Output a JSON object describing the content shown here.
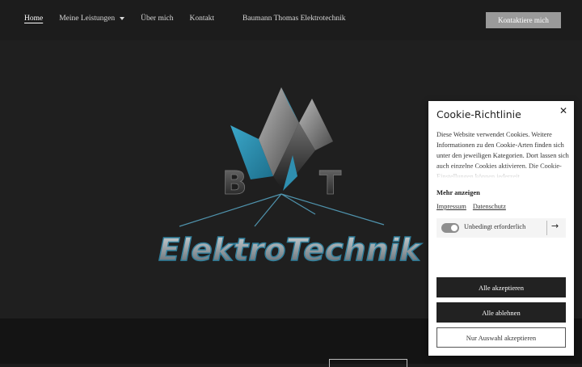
{
  "nav": {
    "items": [
      "Home",
      "Meine Leistungen",
      "Über mich",
      "Kontakt"
    ],
    "brand": "Baumann Thomas Elektrotechnik",
    "contact_button": "Kontaktiere mich"
  },
  "logo": {
    "letter_left": "B",
    "letter_right": "T",
    "wordmark": "ElektroTechnik"
  },
  "cookie": {
    "title": "Cookie-Richtlinie",
    "text": "Diese Website verwendet Cookies. Weitere Informationen zu den Cookie-Arten finden sich unter den jeweiligen Kategorien. Dort lassen sich auch einzelne Cookies aktivieren. Die Cookie-Einstellungen können jederzeit",
    "more": "Mehr anzeigen",
    "link_impressum": "Impressum",
    "link_datenschutz": "Datenschutz",
    "toggle_label": "Unbedingt erforderlich",
    "accept_all": "Alle akzeptieren",
    "reject_all": "Alle ablehnen",
    "accept_selection": "Nur Auswahl akzeptieren"
  },
  "colors": {
    "accent_blue": "#2f8fb0",
    "background": "#1f1f1f"
  }
}
